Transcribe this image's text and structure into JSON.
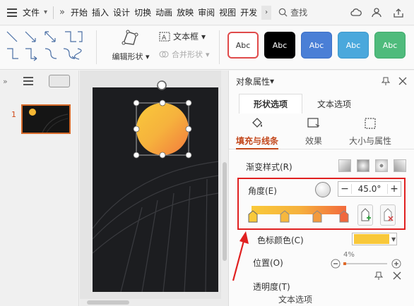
{
  "menubar": {
    "file_label": "文件",
    "tabs": [
      "开始",
      "插入",
      "设计",
      "切换",
      "动画",
      "放映",
      "审阅",
      "视图",
      "开发"
    ],
    "search_label": "查找"
  },
  "ribbon": {
    "edit_shape_label": "编辑形状",
    "textbox_label": "文本框",
    "merge_shape_label": "合并形状",
    "style_swatches": [
      {
        "label": "Abc",
        "bg": "#ffffff",
        "fg": "#333333",
        "border": "#e04a4a"
      },
      {
        "label": "Abc",
        "bg": "#000000",
        "fg": "#ffffff",
        "border": "#000000"
      },
      {
        "label": "Abc",
        "bg": "#4a7fd6",
        "fg": "#ffffff",
        "border": "#3a6fc6"
      },
      {
        "label": "Abc",
        "bg": "#4aa8dc",
        "fg": "#ffffff",
        "border": "#3a98cc"
      },
      {
        "label": "Abc",
        "bg": "#4fbb7c",
        "fg": "#ffffff",
        "border": "#3fab6c"
      }
    ]
  },
  "slides_panel": {
    "slide_number": "1"
  },
  "properties": {
    "title": "对象属性",
    "tab_shape": "形状选项",
    "tab_text": "文本选项",
    "subtab_fill": "填充与线条",
    "subtab_effect": "效果",
    "subtab_size": "大小与属性",
    "gradient_style_label": "渐变样式(R)",
    "angle_label": "角度(E)",
    "angle_value": "45.0°",
    "stop_color_label": "色标颜色(C)",
    "position_label": "位置(O)",
    "position_value": "4%",
    "transparency_label": "透明度(T)",
    "bottom_text_tab": "文本选项"
  },
  "colors": {
    "accent": "#c3471b",
    "highlight_box": "#e02020",
    "stop_color": "#f8c83a"
  }
}
